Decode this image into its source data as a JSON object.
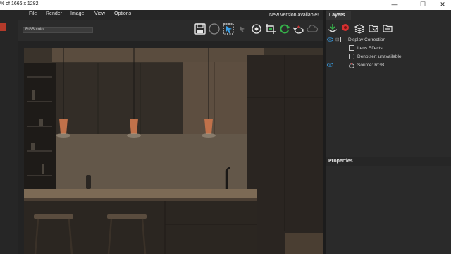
{
  "window": {
    "title": "% of 1666 x 1282]",
    "minimize_glyph": "—",
    "maximize_glyph": "☐",
    "close_glyph": "✕"
  },
  "menu": {
    "items": [
      "File",
      "Render",
      "Image",
      "View",
      "Options"
    ]
  },
  "notice": "New version available!",
  "toolbar": {
    "channel_select": "RGB color",
    "icons": [
      "save-icon",
      "circle-icon",
      "region-select-icon",
      "track-mouse-icon",
      "lens-analysis-icon",
      "crop-icon",
      "refresh-icon",
      "teapot-icon",
      "cloud-icon"
    ]
  },
  "layers_panel": {
    "tab_label": "Layers",
    "tools": [
      "load-layer-icon",
      "red-marker-icon",
      "stack-layers-icon",
      "folder-open-icon",
      "folder-icon"
    ],
    "tree": [
      {
        "label": "Display Correction",
        "visible": true
      },
      {
        "label": "Lens Effects",
        "visible": false
      },
      {
        "label": "Denoiser: unavailable",
        "visible": false
      },
      {
        "label": "Source: RGB",
        "visible": true
      }
    ]
  },
  "properties_panel": {
    "label": "Properties"
  },
  "colors": {
    "accent_green": "#36b24a",
    "accent_red": "#d33030",
    "accent_blue": "#3aa0e8",
    "copper": "#c0714a"
  }
}
